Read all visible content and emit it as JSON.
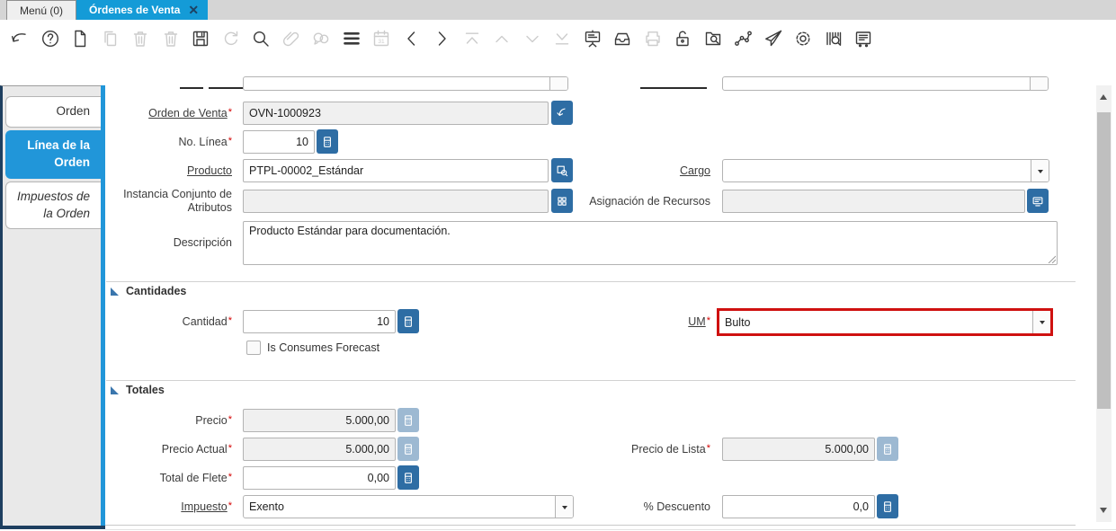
{
  "ui": {
    "required_marker": "*"
  },
  "tab_bar": {
    "menu_tab": "Menú (0)",
    "active_tab": "Órdenes de Venta",
    "close_icon": "✕"
  },
  "toolbar": {
    "icons": [
      {
        "name": "undo-icon",
        "enabled": true
      },
      {
        "name": "help-icon",
        "enabled": true
      },
      {
        "name": "new-record-icon",
        "enabled": true
      },
      {
        "name": "copy-record-icon",
        "enabled": false
      },
      {
        "name": "delete-record-icon",
        "enabled": false
      },
      {
        "name": "delete-selection-icon",
        "enabled": false
      },
      {
        "name": "save-icon",
        "enabled": true
      },
      {
        "name": "refresh-icon",
        "enabled": false
      },
      {
        "name": "find-icon",
        "enabled": true
      },
      {
        "name": "attachment-icon",
        "enabled": false
      },
      {
        "name": "chat-icon",
        "enabled": false
      },
      {
        "name": "grid-toggle-icon",
        "enabled": true
      },
      {
        "name": "calendar-icon",
        "enabled": false
      },
      {
        "name": "previous-record-icon",
        "enabled": true
      },
      {
        "name": "next-record-icon",
        "enabled": true
      },
      {
        "name": "first-record-icon",
        "enabled": false
      },
      {
        "name": "up-record-icon",
        "enabled": false
      },
      {
        "name": "down-record-icon",
        "enabled": false
      },
      {
        "name": "last-record-icon",
        "enabled": false
      },
      {
        "name": "report-icon",
        "enabled": true
      },
      {
        "name": "archive-icon",
        "enabled": true
      },
      {
        "name": "print-icon",
        "enabled": false
      },
      {
        "name": "lock-icon",
        "enabled": true
      },
      {
        "name": "zoom-across-icon",
        "enabled": true
      },
      {
        "name": "workflow-icon",
        "enabled": true
      },
      {
        "name": "send-icon",
        "enabled": true
      },
      {
        "name": "preferences-icon",
        "enabled": true
      },
      {
        "name": "product-info-icon",
        "enabled": true
      },
      {
        "name": "feedback-icon",
        "enabled": true
      }
    ]
  },
  "sidebar": {
    "tabs": [
      {
        "id": "orden",
        "label": "Orden",
        "active": false,
        "italic": false
      },
      {
        "id": "linea-de-la-orden",
        "label": "Línea de la Orden",
        "active": true,
        "italic": false
      },
      {
        "id": "impuestos-de-la-orden",
        "label": "Impuestos de la Orden",
        "active": false,
        "italic": true
      }
    ]
  },
  "form": {
    "orden_de_venta": {
      "label": "Orden de Venta",
      "value": "OVN-1000923"
    },
    "no_linea": {
      "label": "No. Línea",
      "value": "10"
    },
    "producto": {
      "label": "Producto",
      "value": "PTPL-00002_Estándar"
    },
    "cargo": {
      "label": "Cargo",
      "value": ""
    },
    "instancia": {
      "label": "Instancia Conjunto de Atributos",
      "value": ""
    },
    "asignacion": {
      "label": "Asignación de Recursos",
      "value": ""
    },
    "descripcion": {
      "label": "Descripción",
      "value": "Producto Estándar para documentación."
    },
    "cantidades": {
      "title": "Cantidades",
      "cantidad": {
        "label": "Cantidad",
        "value": "10"
      },
      "um": {
        "label": "UM",
        "value": "Bulto",
        "highlighted": true
      },
      "is_consumes_forecast": {
        "label": "Is Consumes Forecast",
        "checked": false
      }
    },
    "totales": {
      "title": "Totales",
      "precio": {
        "label": "Precio",
        "value": "5.000,00"
      },
      "precio_actual": {
        "label": "Precio Actual",
        "value": "5.000,00"
      },
      "precio_lista": {
        "label": "Precio de Lista",
        "value": "5.000,00"
      },
      "total_flete": {
        "label": "Total de Flete",
        "value": "0,00"
      },
      "impuesto": {
        "label": "Impuesto",
        "value": "Exento"
      },
      "descuento": {
        "label": "% Descuento",
        "value": "0,0"
      }
    }
  },
  "colors": {
    "tab_active_blue": "#149bd7",
    "sidebar_active_blue": "#2196d9",
    "button_blue": "#2e6da4",
    "highlight_red": "#cf1110",
    "dark_frame": "#1e3f60"
  }
}
